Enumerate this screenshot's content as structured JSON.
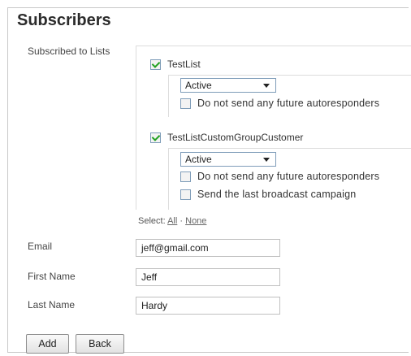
{
  "page": {
    "title": "Subscribers"
  },
  "lists_label": "Subscribed to Lists",
  "lists": [
    {
      "name": "TestList",
      "checked": true,
      "status": "Active",
      "options": [
        {
          "label": "Do not send any future autoresponders",
          "checked": false
        }
      ]
    },
    {
      "name": "TestListCustomGroupCustomer",
      "checked": true,
      "status": "Active",
      "options": [
        {
          "label": "Do not send any future autoresponders",
          "checked": false
        },
        {
          "label": "Send the last broadcast campaign",
          "checked": false
        }
      ]
    }
  ],
  "select_links": {
    "prefix": "Select:",
    "all": "All",
    "separator": "·",
    "none": "None"
  },
  "fields": [
    {
      "label": "Email",
      "value": "jeff@gmail.com"
    },
    {
      "label": "First Name",
      "value": "Jeff"
    },
    {
      "label": "Last Name",
      "value": "Hardy"
    }
  ],
  "buttons": {
    "add": "Add",
    "back": "Back"
  }
}
